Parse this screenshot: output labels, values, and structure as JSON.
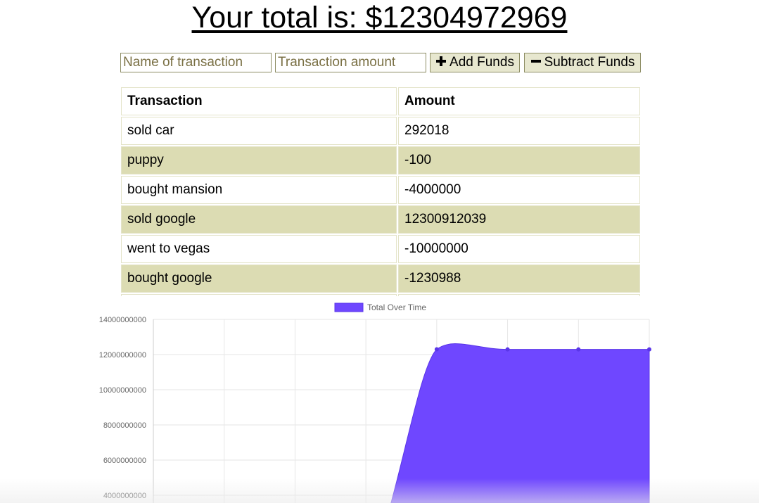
{
  "header": {
    "total_text": "Your total is: $12304972969"
  },
  "form": {
    "name_placeholder": "Name of transaction",
    "amount_placeholder": "Transaction amount",
    "add_label": "Add Funds",
    "subtract_label": "Subtract Funds",
    "add_icon": "plus-icon",
    "subtract_icon": "minus-icon"
  },
  "table": {
    "headers": [
      "Transaction",
      "Amount"
    ],
    "rows": [
      [
        "sold car",
        "292018"
      ],
      [
        "puppy",
        "-100"
      ],
      [
        "bought mansion",
        "-4000000"
      ],
      [
        "sold google",
        "12300912039"
      ],
      [
        "went to vegas",
        "-10000000"
      ],
      [
        "bought google",
        "-1230988"
      ]
    ]
  },
  "colors": {
    "row_alt": "#dcdcb3",
    "button_bg": "#e7e7cf",
    "chart_fill": "#6f47ff"
  },
  "chart_data": {
    "type": "area",
    "title": "",
    "legend": {
      "position": "top",
      "entries": [
        "Total Over Time"
      ]
    },
    "series": [
      {
        "name": "Total Over Time",
        "values": [
          null,
          null,
          null,
          null,
          12300912039,
          12296912039,
          12296911939,
          12297203957
        ]
      }
    ],
    "x": [
      0,
      1,
      2,
      3,
      4,
      5,
      6,
      7
    ],
    "ylim": [
      0,
      14000000000
    ],
    "y_ticks": [
      "14000000000",
      "12000000000",
      "10000000000",
      "8000000000",
      "6000000000",
      "4000000000"
    ],
    "grid": true
  }
}
